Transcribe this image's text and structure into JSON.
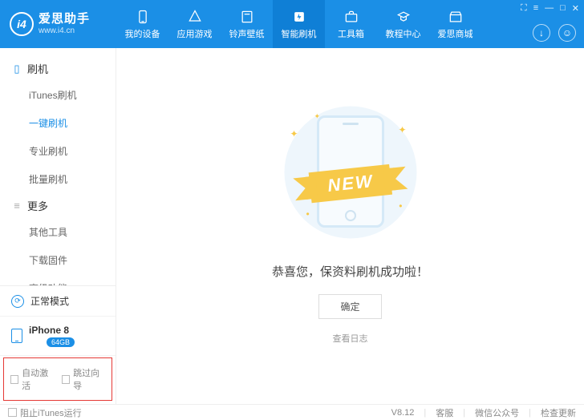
{
  "brand": {
    "name": "爱思助手",
    "url": "www.i4.cn",
    "logo_letters": "i4"
  },
  "nav": [
    {
      "icon": "device",
      "label": "我的设备"
    },
    {
      "icon": "apps",
      "label": "应用游戏"
    },
    {
      "icon": "ring",
      "label": "铃声壁纸"
    },
    {
      "icon": "flash",
      "label": "智能刷机",
      "active": true
    },
    {
      "icon": "toolbox",
      "label": "工具箱"
    },
    {
      "icon": "tutorial",
      "label": "教程中心"
    },
    {
      "icon": "store",
      "label": "爱思商城"
    }
  ],
  "sidebar": {
    "group1": {
      "title": "刷机",
      "items": [
        "iTunes刷机",
        "一键刷机",
        "专业刷机",
        "批量刷机"
      ],
      "active_index": 1
    },
    "group2": {
      "title": "更多",
      "items": [
        "其他工具",
        "下载固件",
        "高级功能"
      ]
    }
  },
  "mode": {
    "label": "正常模式"
  },
  "device": {
    "name": "iPhone 8",
    "storage": "64GB"
  },
  "bottom_checks": {
    "auto_activate": "自动激活",
    "skip_setup": "跳过向导"
  },
  "main": {
    "ribbon": "NEW",
    "success": "恭喜您，保资料刷机成功啦！",
    "confirm": "确定",
    "view_log": "查看日志"
  },
  "footer": {
    "block_itunes": "阻止iTunes运行",
    "version": "V8.12",
    "support": "客服",
    "wechat": "微信公众号",
    "update": "检查更新"
  }
}
